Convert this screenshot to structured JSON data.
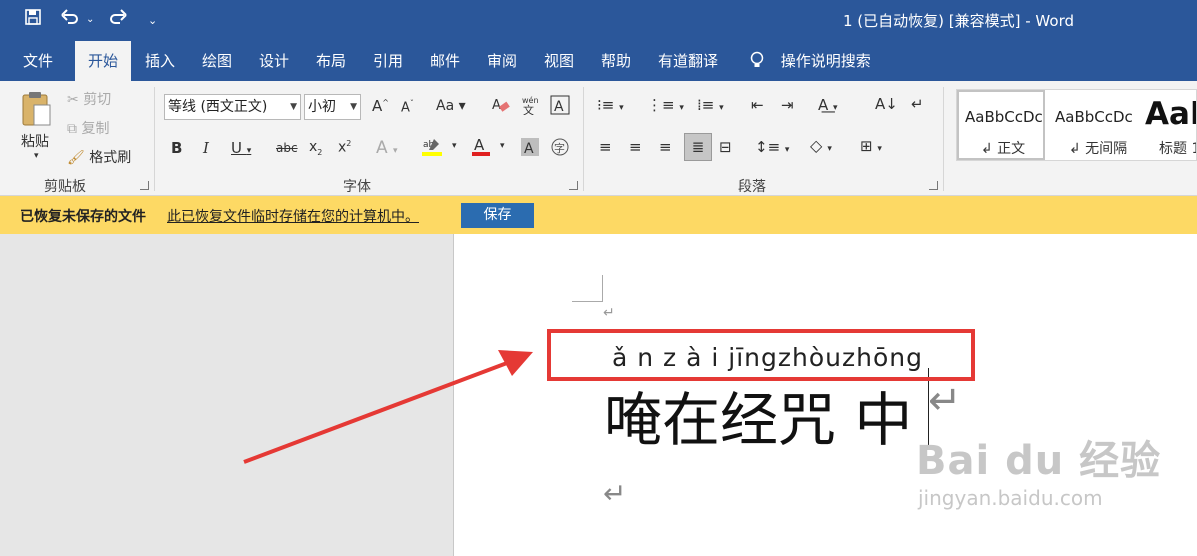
{
  "window": {
    "title": "1 (已自动恢复) [兼容模式]  -  Word"
  },
  "quick_access": {
    "save_icon": "save-icon",
    "undo_icon": "undo-icon",
    "redo_icon": "redo-icon",
    "customize_icon": "customize-icon"
  },
  "tabs": [
    "文件",
    "开始",
    "插入",
    "绘图",
    "设计",
    "布局",
    "引用",
    "邮件",
    "审阅",
    "视图",
    "帮助",
    "有道翻译"
  ],
  "tell_me": "操作说明搜索",
  "ribbon": {
    "clipboard": {
      "paste": "粘贴",
      "cut": "剪切",
      "copy": "复制",
      "format_painter": "格式刷",
      "label": "剪贴板"
    },
    "font": {
      "font_name": "等线 (西文正文)",
      "font_size": "小初",
      "label": "字体"
    },
    "paragraph": {
      "label": "段落"
    },
    "styles": {
      "items": [
        {
          "preview": "AaBbCcDc",
          "name": "↲ 正文"
        },
        {
          "preview": "AaBbCcDc",
          "name": "↲ 无间隔"
        },
        {
          "preview": "AaB",
          "name": "标题 1"
        }
      ]
    }
  },
  "notification": {
    "title": "已恢复未保存的文件",
    "message": "此已恢复文件临时存储在您的计算机中。",
    "button": "保存"
  },
  "document": {
    "pinyin": "ǎ n z à i jīngzhòuzhōng",
    "text": "唵在经咒 中",
    "paragraph_mark": "↵"
  },
  "watermark": {
    "brand": "Bai du 经验",
    "url": "jingyan.baidu.com"
  },
  "colors": {
    "title_bar": "#2b579a",
    "ribbon_bg": "#f3f3f3",
    "notify_bg": "#fdd964",
    "annotation": "#e53935"
  }
}
